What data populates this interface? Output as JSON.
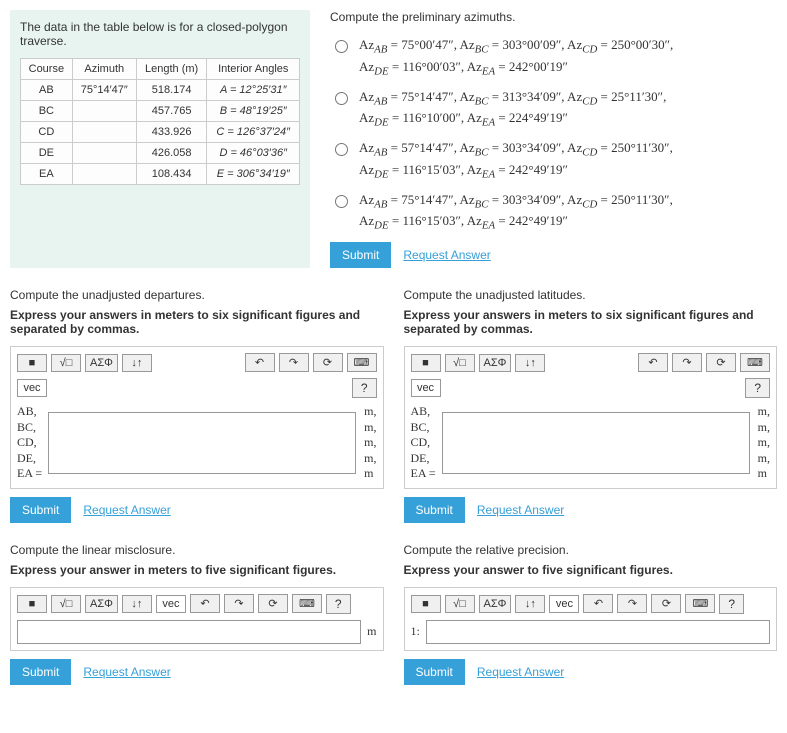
{
  "data_panel": {
    "intro": "The data in the table below is for a closed-polygon traverse.",
    "headers": [
      "Course",
      "Azimuth",
      "Length (m)",
      "Interior Angles"
    ],
    "rows": [
      {
        "course": "AB",
        "azimuth": "75°14′47″",
        "length": "518.174",
        "angle": "A = 12°25′31″"
      },
      {
        "course": "BC",
        "azimuth": "",
        "length": "457.765",
        "angle": "B = 48°19′25″"
      },
      {
        "course": "CD",
        "azimuth": "",
        "length": "433.926",
        "angle": "C = 126°37′24″"
      },
      {
        "course": "DE",
        "azimuth": "",
        "length": "426.058",
        "angle": "D = 46°03′36″"
      },
      {
        "course": "EA",
        "azimuth": "",
        "length": "108.434",
        "angle": "E = 306°34′19″"
      }
    ]
  },
  "azimuths": {
    "prompt": "Compute the preliminary azimuths.",
    "options": [
      "Az_AB = 75°00′47″, Az_BC = 303°00′09″, Az_CD = 250°00′30″, Az_DE = 116°00′03″, Az_EA = 242°00′19″",
      "Az_AB = 75°14′47″, Az_BC = 313°34′09″, Az_CD = 25°11′30″, Az_DE = 116°10′00″, Az_EA = 224°49′19″",
      "Az_AB = 57°14′47″, Az_BC = 303°34′09″, Az_CD = 250°11′30″, Az_DE = 116°15′03″, Az_EA = 242°49′19″",
      "Az_AB = 75°14′47″, Az_BC = 303°34′09″, Az_CD = 250°11′30″, Az_DE = 116°15′03″, Az_EA = 242°49′19″"
    ],
    "submit": "Submit",
    "request": "Request Answer"
  },
  "departures": {
    "title": "Compute the unadjusted departures.",
    "instruct": "Express your answers in meters to six significant figures and separated by commas.",
    "labels": "AB,\nBC,\nCD,\nDE,\nEA =",
    "units": "m,\nm,\nm,\nm,\nm",
    "submit": "Submit",
    "request": "Request Answer"
  },
  "latitudes": {
    "title": "Compute the unadjusted latitudes.",
    "instruct": "Express your answers in meters to six significant figures and separated by commas.",
    "labels": "AB,\nBC,\nCD,\nDE,\nEA =",
    "units": "m,\nm,\nm,\nm,\nm",
    "submit": "Submit",
    "request": "Request Answer"
  },
  "misclosure": {
    "title": "Compute the linear misclosure.",
    "instruct": "Express your answer in meters to five significant figures.",
    "unit": "m",
    "submit": "Submit",
    "request": "Request Answer"
  },
  "precision": {
    "title": "Compute the relative precision.",
    "instruct": "Express your answer to five significant figures.",
    "prefix": "1:",
    "submit": "Submit",
    "request": "Request Answer"
  },
  "toolbar": {
    "template": "■",
    "sqrt": "√□",
    "greek": "ΑΣΦ",
    "updown": "↓↑",
    "vec": "vec",
    "undo": "↶",
    "redo": "↷",
    "reset": "⟳",
    "keyboard": "⌨",
    "help": "?"
  }
}
